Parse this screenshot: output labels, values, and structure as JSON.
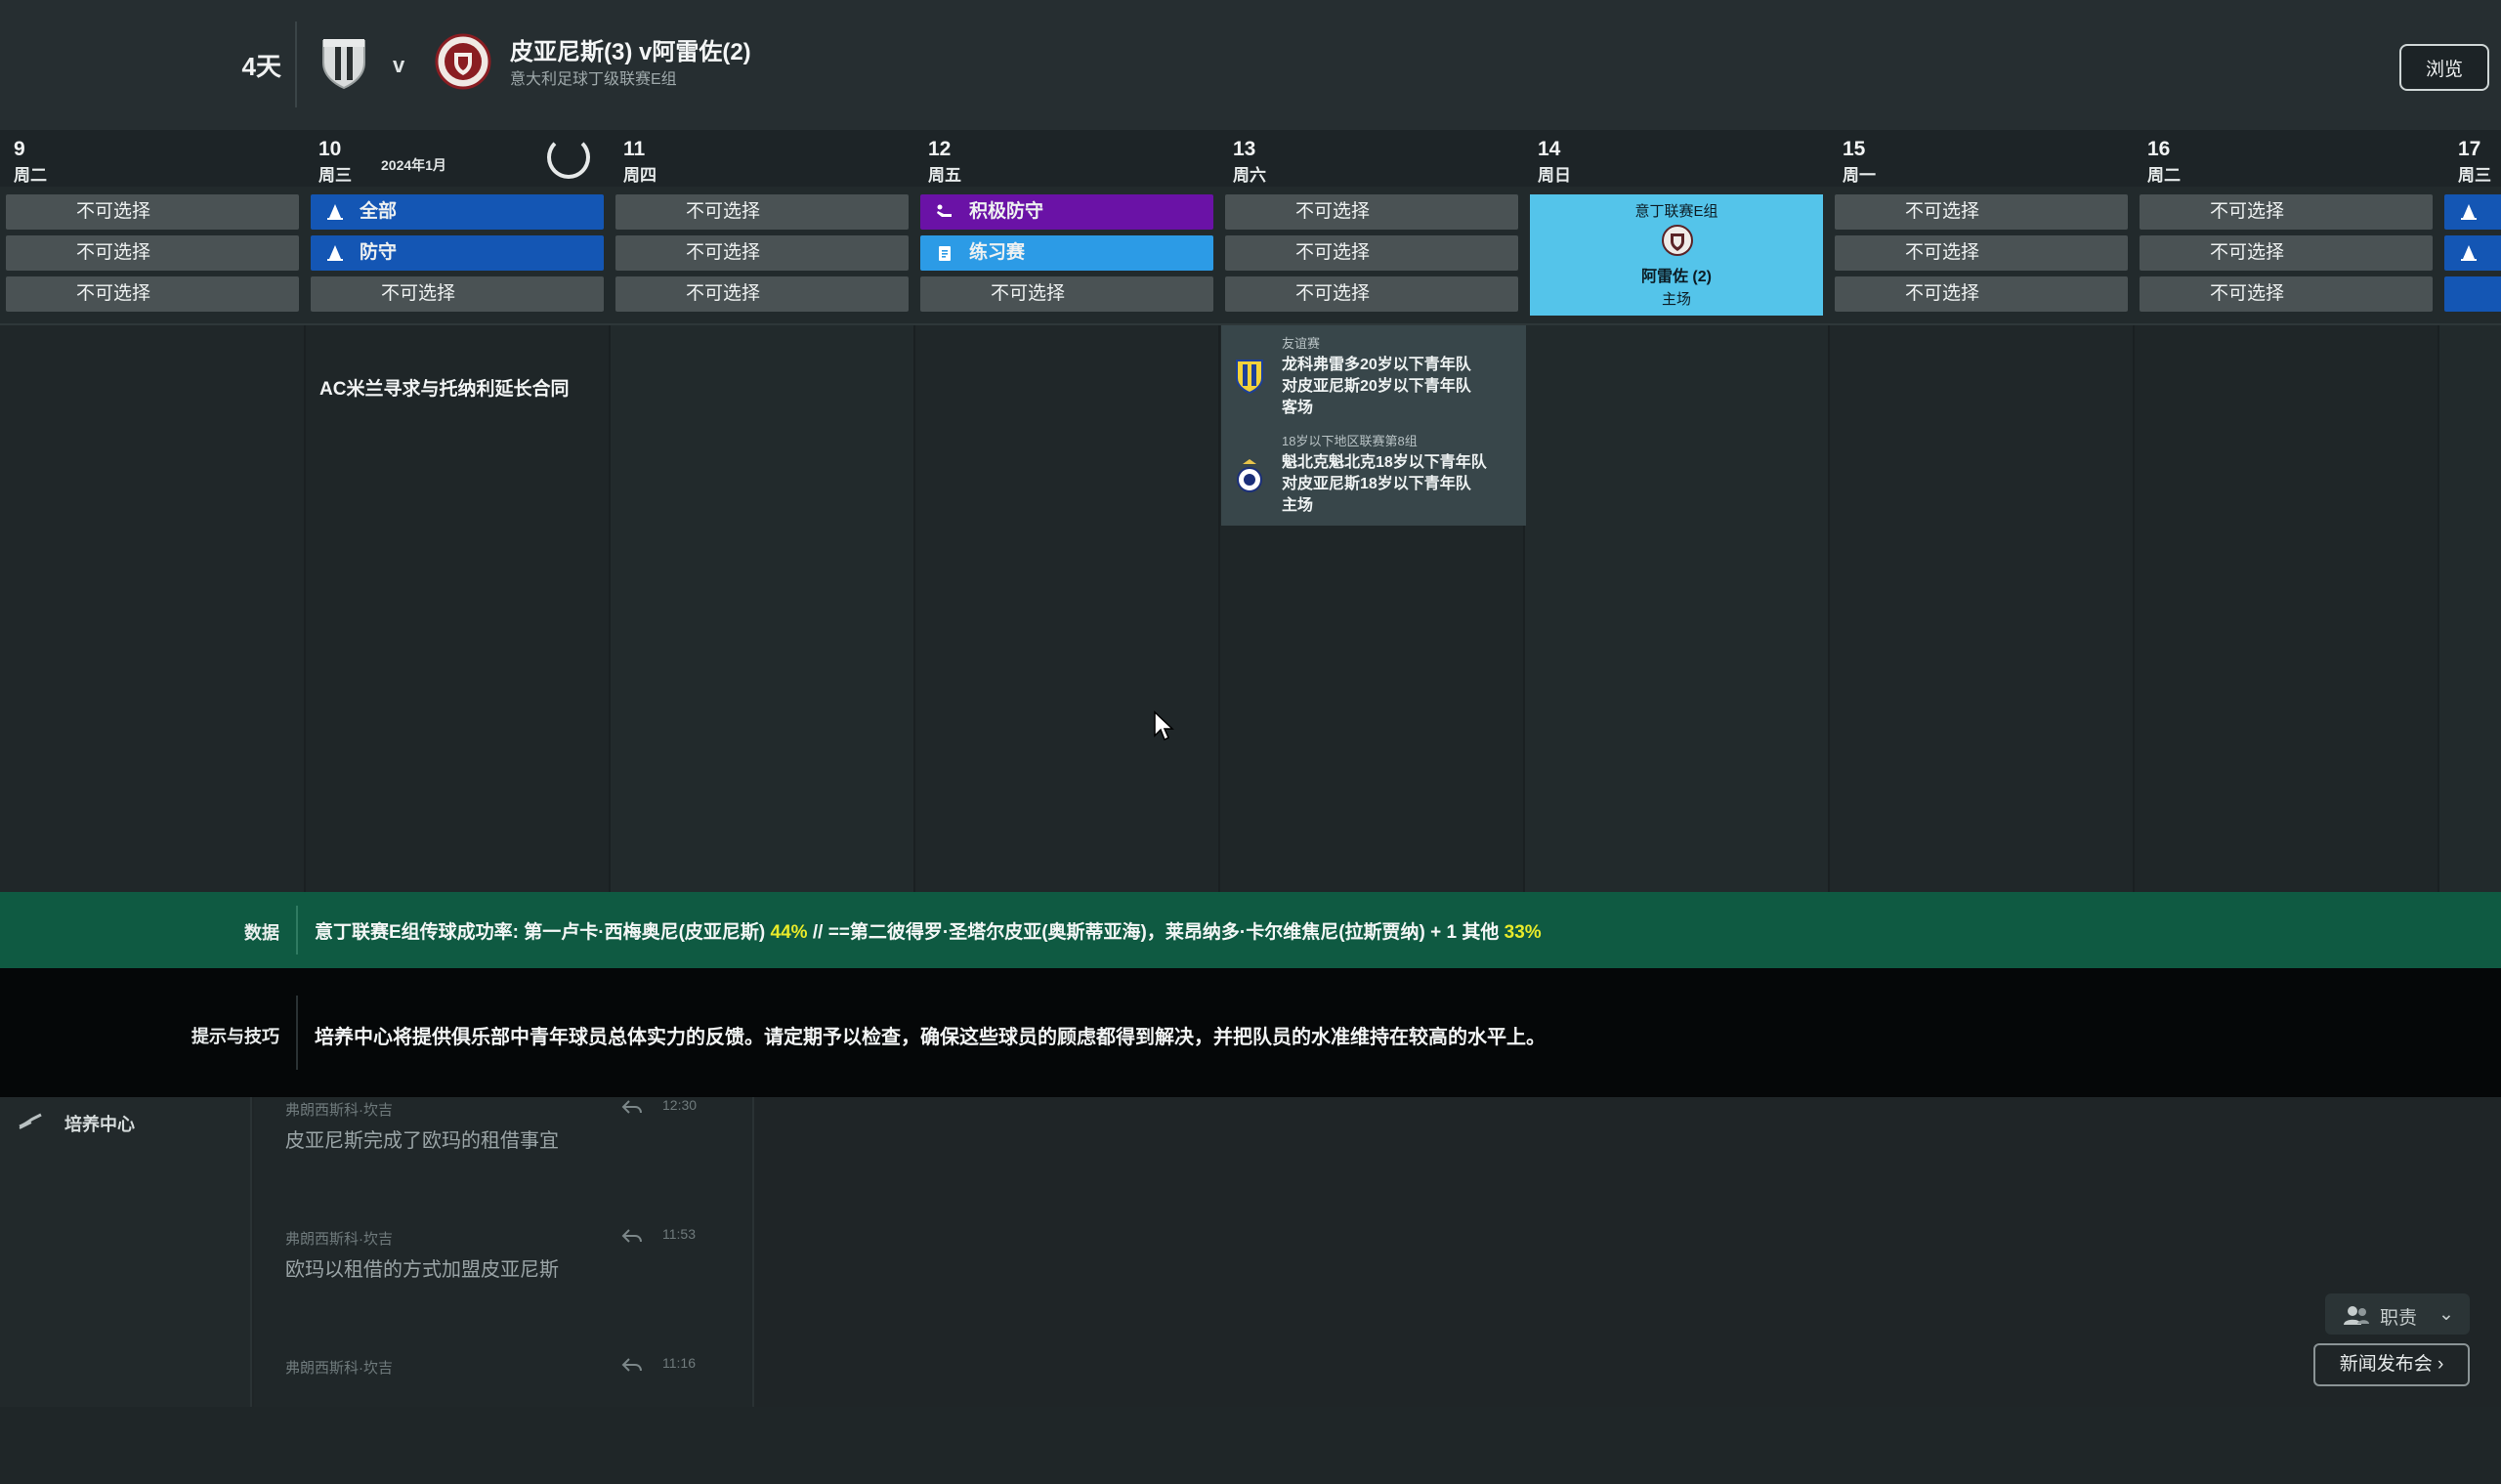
{
  "header": {
    "days_until": "4天",
    "vs": "v",
    "match_title": "皮亚尼斯(3) v阿雷佐(2)",
    "competition": "意大利足球丁级联赛E组",
    "browse_label": "浏览"
  },
  "calendar": {
    "month_label": "2024年1月",
    "unavailable": "不可选择",
    "days": [
      {
        "num": "9",
        "weekday": "周二"
      },
      {
        "num": "10",
        "weekday": "周三"
      },
      {
        "num": "11",
        "weekday": "周四"
      },
      {
        "num": "12",
        "weekday": "周五"
      },
      {
        "num": "13",
        "weekday": "周六"
      },
      {
        "num": "14",
        "weekday": "周日"
      },
      {
        "num": "15",
        "weekday": "周一"
      },
      {
        "num": "16",
        "weekday": "周二"
      },
      {
        "num": "17",
        "weekday": "周三"
      }
    ],
    "training": {
      "day10_slot1": "全部",
      "day10_slot2": "防守",
      "day12_slot1": "积极防守",
      "day12_slot2": "练习赛"
    },
    "match_card": {
      "competition": "意丁联赛E组",
      "opponent": "阿雷佐 (2)",
      "venue": "主场"
    },
    "news_note": "AC米兰寻求与托纳利延长合同",
    "fixtures": [
      {
        "competition": "友谊赛",
        "line1": "龙科弗雷多20岁以下青年队",
        "line2": "对皮亚尼斯20岁以下青年队",
        "line3": "客场"
      },
      {
        "competition": "18岁以下地区联赛第8组",
        "line1": "魁北克魁北克18岁以下青年队",
        "line2": "对皮亚尼斯18岁以下青年队",
        "line3": "主场"
      }
    ]
  },
  "data_bar": {
    "label": "数据",
    "text_a": "意丁联赛E组传球成功率: 第一卢卡·西梅奥尼(皮亚尼斯) ",
    "value_a": "44%",
    "text_b": " // ==第二彼得罗·圣塔尔皮亚(奥斯蒂亚海)，莱昂纳多·卡尔维焦尼(拉斯贾纳) + 1 其他 ",
    "value_b": "33%"
  },
  "tips": {
    "label": "提示与技巧",
    "text": "培养中心将提供俱乐部中青年球员总体实力的反馈。请定期予以检查，确保这些球员的顾虑都得到解决，并把队员的水准维持在较高的水平上。"
  },
  "inbox": {
    "side_item": "培养中心",
    "messages": [
      {
        "from": "弗朗西斯科·坎吉",
        "time": "12:30",
        "subject": "皮亚尼斯完成了欧玛的租借事宜"
      },
      {
        "from": "弗朗西斯科·坎吉",
        "time": "11:53",
        "subject": "欧玛以租借的方式加盟皮亚尼斯"
      },
      {
        "from": "弗朗西斯科·坎吉",
        "time": "11:16",
        "subject": ""
      }
    ],
    "role_label": "职责",
    "press_label": "新闻发布会 ›"
  },
  "colors": {
    "training_blue": "#1456b4",
    "training_purple": "#6a12a6",
    "training_sky": "#2c9be6",
    "match_card": "#54c4ea",
    "data_bar": "#0f5a42",
    "highlight": "#e8ea2a"
  },
  "icons": {
    "training": "cone-icon",
    "aggressive": "sliding-tackle-icon",
    "practice": "clipboard-icon",
    "development": "trend-icon",
    "reply": "reply-icon",
    "role": "people-icon"
  }
}
